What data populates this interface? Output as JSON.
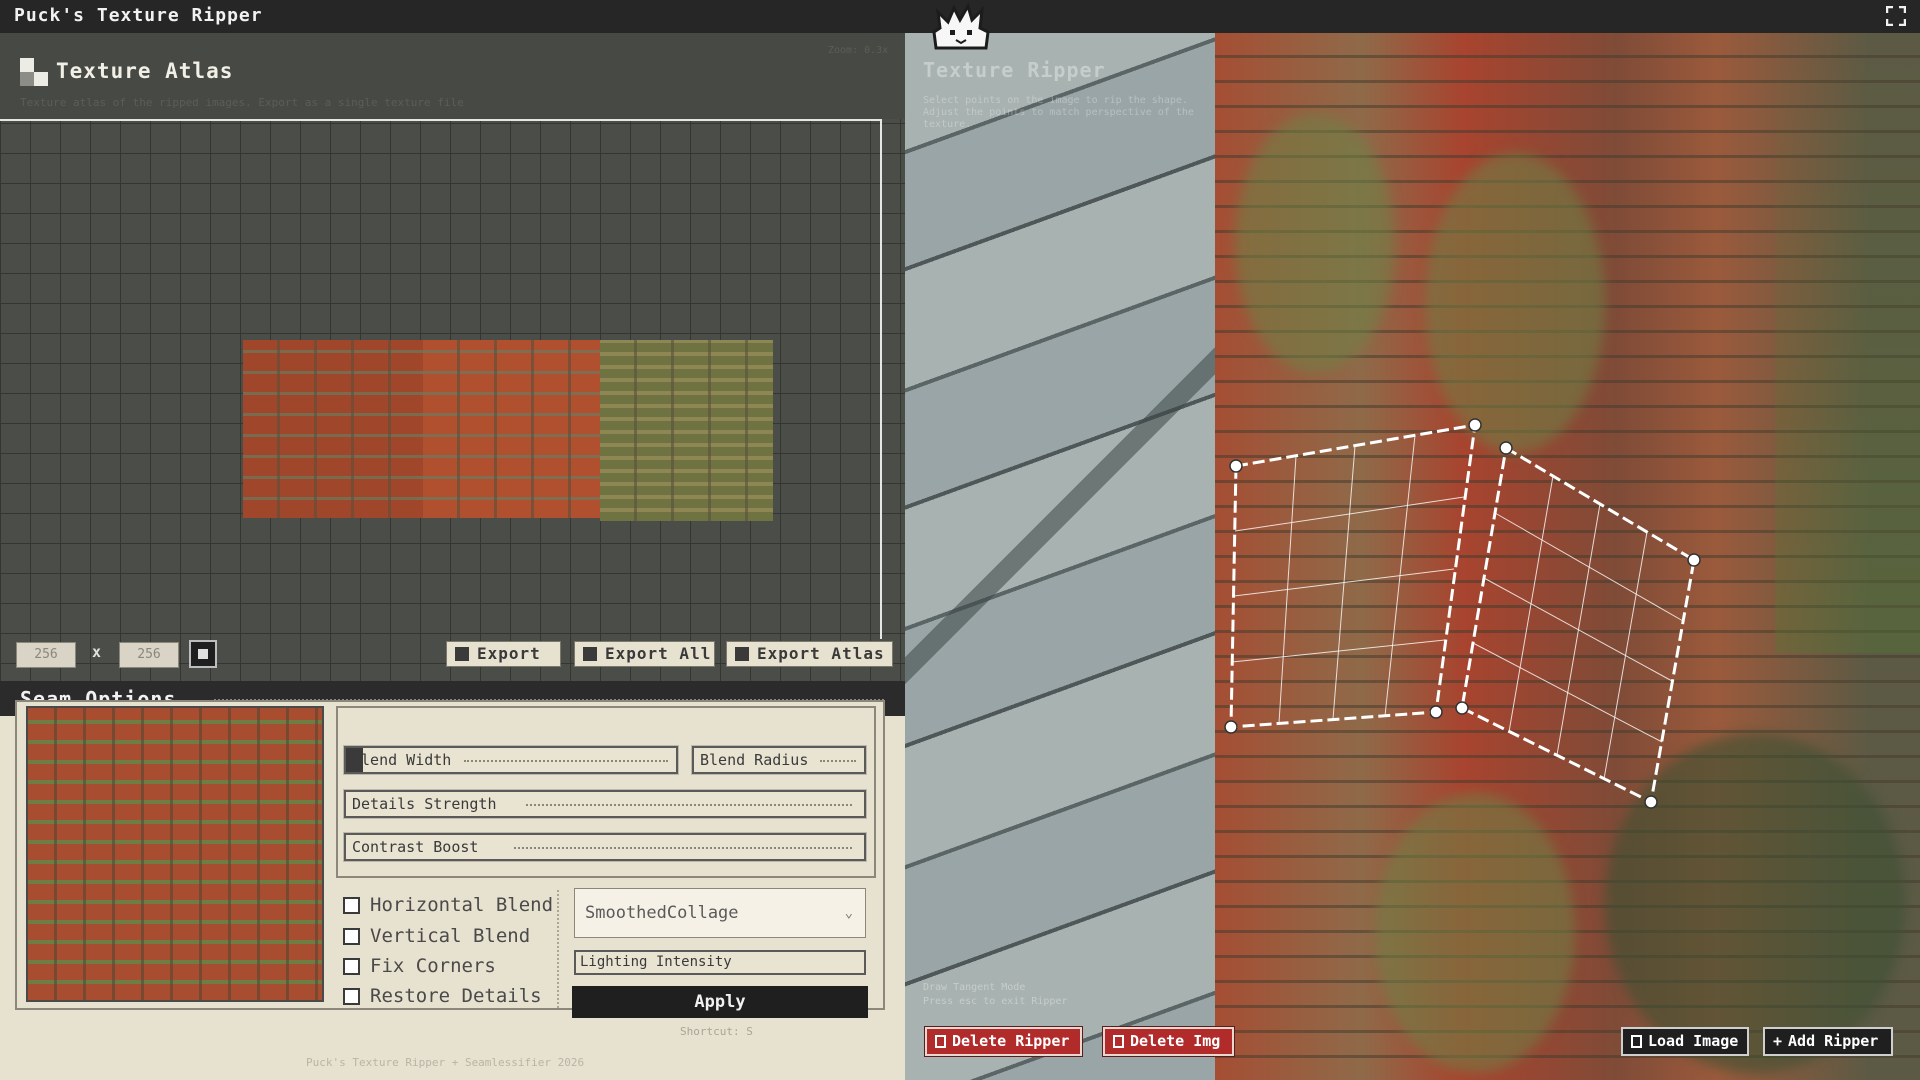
{
  "app": {
    "title": "Puck's Texture Ripper"
  },
  "atlas": {
    "title": "Texture Atlas",
    "description": "Texture atlas of the ripped images. Export as a single texture file",
    "zoom": "Zoom: 0.3x",
    "width": "256",
    "height": "256",
    "x_label": "x",
    "export_label": "Export",
    "export_all_label": "Export All",
    "export_atlas_label": "Export Atlas"
  },
  "seam": {
    "title": "Seam Options",
    "blend_width": "Blend Width",
    "blend_width_level": 0.05,
    "blend_radius": "Blend Radius",
    "details_strength": "Details Strength",
    "contrast_boost": "Contrast Boost",
    "horizontal_blend": "Horizontal Blend",
    "vertical_blend": "Vertical Blend",
    "fix_corners": "Fix Corners",
    "restore_details": "Restore Details",
    "mode": "SmoothedCollage",
    "lighting_intensity": "Lighting Intensity",
    "apply_label": "Apply",
    "shortcut": "Shortcut: S"
  },
  "footer": "Puck's Texture Ripper + Seamlessifier 2026",
  "ripper": {
    "title": "Texture Ripper",
    "description": "Select points on the image to rip the shape. Adjust the points to match perspective of the texture.",
    "mode_line": "Draw Tangent Mode",
    "hint_line": "Press esc to exit Ripper",
    "delete_ripper_label": "Delete Ripper",
    "delete_img_label": "Delete Img",
    "load_image_label": "Load Image",
    "add_ripper_label": "Add Ripper"
  },
  "colors": {
    "accent_red": "#b22b2b",
    "panel_bg": "#e7e1cf",
    "dark": "#1f1f1f"
  }
}
